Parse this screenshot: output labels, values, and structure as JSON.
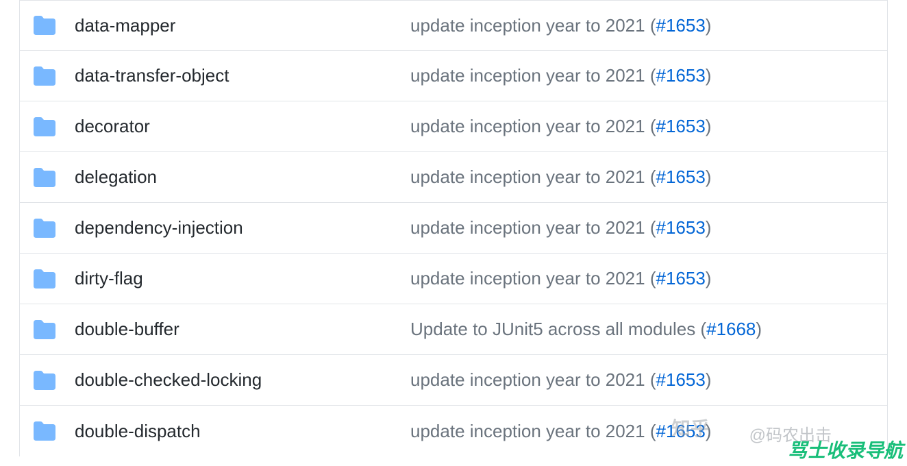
{
  "rows": [
    {
      "name": "data-mapper",
      "commit_prefix": "update inception year to 2021 (",
      "issue": "#1653",
      "commit_suffix": ")"
    },
    {
      "name": "data-transfer-object",
      "commit_prefix": "update inception year to 2021 (",
      "issue": "#1653",
      "commit_suffix": ")"
    },
    {
      "name": "decorator",
      "commit_prefix": "update inception year to 2021 (",
      "issue": "#1653",
      "commit_suffix": ")"
    },
    {
      "name": "delegation",
      "commit_prefix": "update inception year to 2021 (",
      "issue": "#1653",
      "commit_suffix": ")"
    },
    {
      "name": "dependency-injection",
      "commit_prefix": "update inception year to 2021 (",
      "issue": "#1653",
      "commit_suffix": ")"
    },
    {
      "name": "dirty-flag",
      "commit_prefix": "update inception year to 2021 (",
      "issue": "#1653",
      "commit_suffix": ")"
    },
    {
      "name": "double-buffer",
      "commit_prefix": "Update to JUnit5 across all modules (",
      "issue": "#1668",
      "commit_suffix": ")"
    },
    {
      "name": "double-checked-locking",
      "commit_prefix": "update inception year to 2021 (",
      "issue": "#1653",
      "commit_suffix": ")"
    },
    {
      "name": "double-dispatch",
      "commit_prefix": "update inception year to 2021 (",
      "issue": "#1653",
      "commit_suffix": ")"
    }
  ],
  "watermarks": {
    "zhihu": "知乎",
    "author": "@码农出击",
    "site": "骂士收录导航"
  }
}
